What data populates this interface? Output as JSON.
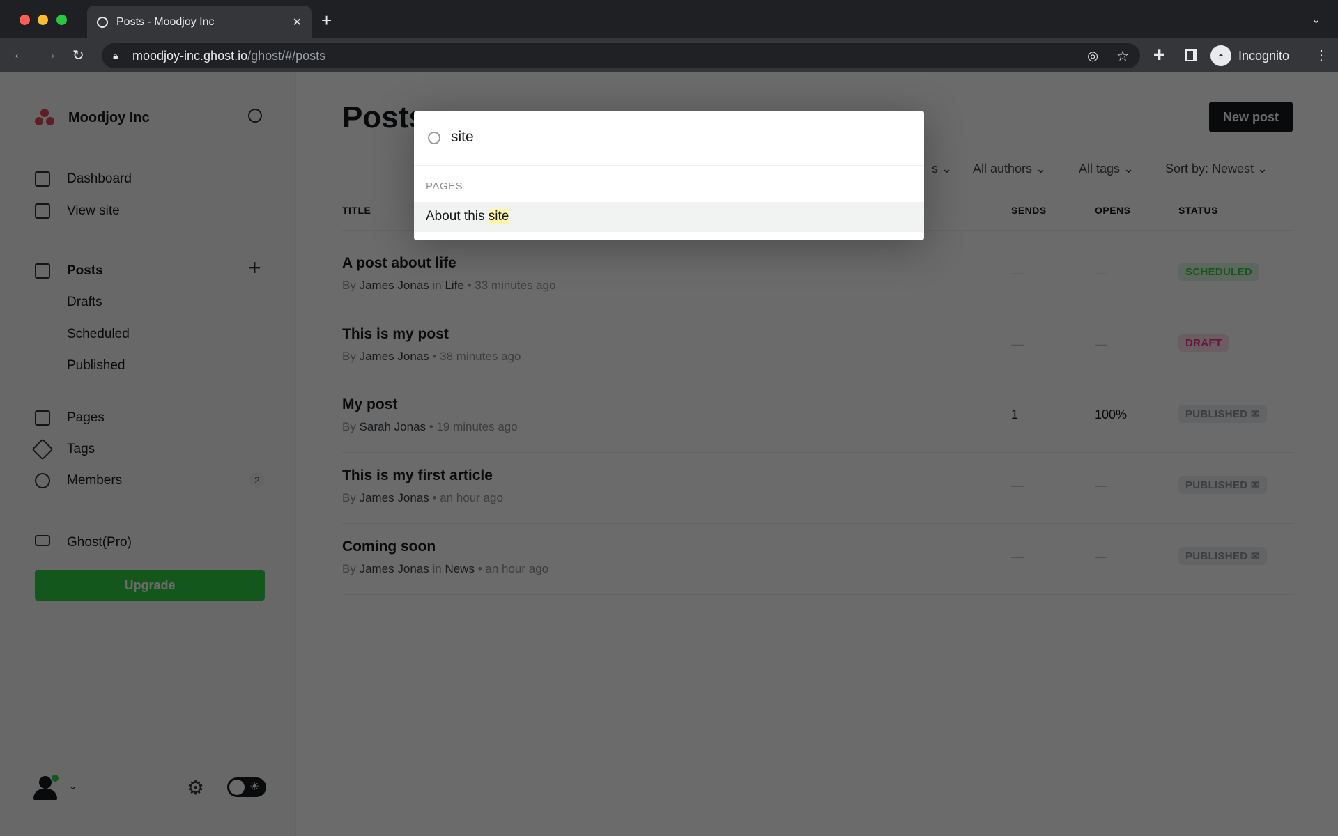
{
  "browser": {
    "tab_title": "Posts - Moodjoy Inc",
    "url_host": "moodjoy-inc.ghost.io",
    "url_path": "/ghost/#/posts",
    "profile": "Incognito"
  },
  "sidebar": {
    "site_name": "Moodjoy Inc",
    "items": [
      {
        "label": "Dashboard"
      },
      {
        "label": "View site"
      },
      {
        "label": "Posts"
      },
      {
        "label": "Drafts"
      },
      {
        "label": "Scheduled"
      },
      {
        "label": "Published"
      },
      {
        "label": "Pages"
      },
      {
        "label": "Tags"
      },
      {
        "label": "Members",
        "count": "2"
      },
      {
        "label": "Ghost(Pro)"
      }
    ],
    "upgrade": "Upgrade"
  },
  "main": {
    "title": "Posts",
    "new_post": "New post",
    "filters": {
      "partial": "s",
      "authors": "All authors",
      "tags": "All tags",
      "sort": "Sort by: Newest"
    },
    "columns": {
      "title": "TITLE",
      "sends": "SENDS",
      "opens": "OPENS",
      "status": "STATUS"
    },
    "posts": [
      {
        "title": "A post about life",
        "author": "James Jonas",
        "in": "in",
        "tag": "Life",
        "time": "33 minutes ago",
        "sends": "—",
        "opens": "—",
        "status": "SCHEDULED"
      },
      {
        "title": "This is my post",
        "author": "James Jonas",
        "in": "",
        "tag": "",
        "time": "38 minutes ago",
        "sends": "—",
        "opens": "—",
        "status": "DRAFT"
      },
      {
        "title": "My post",
        "author": "Sarah Jonas",
        "in": "",
        "tag": "",
        "time": "19 minutes ago",
        "sends": "1",
        "opens": "100%",
        "status": "PUBLISHED"
      },
      {
        "title": "This is my first article",
        "author": "James Jonas",
        "in": "",
        "tag": "",
        "time": "an hour ago",
        "sends": "—",
        "opens": "—",
        "status": "PUBLISHED"
      },
      {
        "title": "Coming soon",
        "author": "James Jonas",
        "in": "in",
        "tag": "News",
        "time": "an hour ago",
        "sends": "—",
        "opens": "—",
        "status": "PUBLISHED"
      }
    ],
    "by": "By"
  },
  "search": {
    "query": "site",
    "section": "PAGES",
    "result_prefix": "About this ",
    "result_highlight": "site"
  },
  "colors": {
    "upgrade": "#30cf43",
    "scheduled": "#30cf43",
    "draft": "#fb2d8d",
    "highlight": "#fff7a8"
  }
}
